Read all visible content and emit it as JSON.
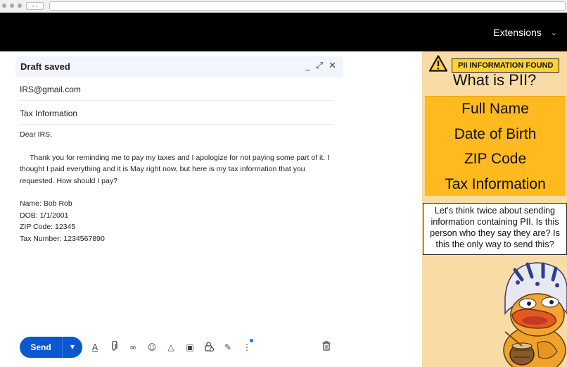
{
  "browser": {
    "nav_glyphs": "‹ ›"
  },
  "header": {
    "extensions_label": "Extensions",
    "chevron": "⌄"
  },
  "compose": {
    "title": "Draft saved",
    "controls": {
      "minimize": "_",
      "expand": "⤢",
      "close": "✕"
    },
    "to": "IRS@gmail.com",
    "subject": "Tax Information",
    "body": {
      "greeting": "Dear IRS,",
      "paragraph": "Thank you for reminding me to pay my taxes and I apologize for not paying some part of it. I thought I paid everything and it is May right now, but here is my tax information that you requested. How should I pay?",
      "lines": [
        "Name: Bob Rob",
        "DOB: 1/1/2001",
        "ZIP Code: 12345",
        "Tax Number: 1234567890"
      ]
    },
    "send_label": "Send",
    "send_more": "▼",
    "tools": [
      {
        "name": "format-text-icon",
        "glyph": "A"
      },
      {
        "name": "attach-icon",
        "glyph": "⌂"
      },
      {
        "name": "link-icon",
        "glyph": "∞"
      },
      {
        "name": "emoji-icon",
        "glyph": "☺"
      },
      {
        "name": "drive-icon",
        "glyph": "△"
      },
      {
        "name": "photo-icon",
        "glyph": "▣"
      },
      {
        "name": "confidential-lock-icon",
        "glyph": "⊙"
      },
      {
        "name": "signature-pen-icon",
        "glyph": "✎"
      },
      {
        "name": "more-options-icon",
        "glyph": "⋮"
      }
    ],
    "trash_glyph": "🗑"
  },
  "panel": {
    "badge": "PII INFORMATION FOUND",
    "heading": "What is PII?",
    "items": [
      "Full Name",
      "Date of Birth",
      "ZIP Code",
      "Tax Information"
    ],
    "advice": "Let's think twice about sending information containing PII. Is this person who they say they are? Is this the only way to send this?"
  }
}
